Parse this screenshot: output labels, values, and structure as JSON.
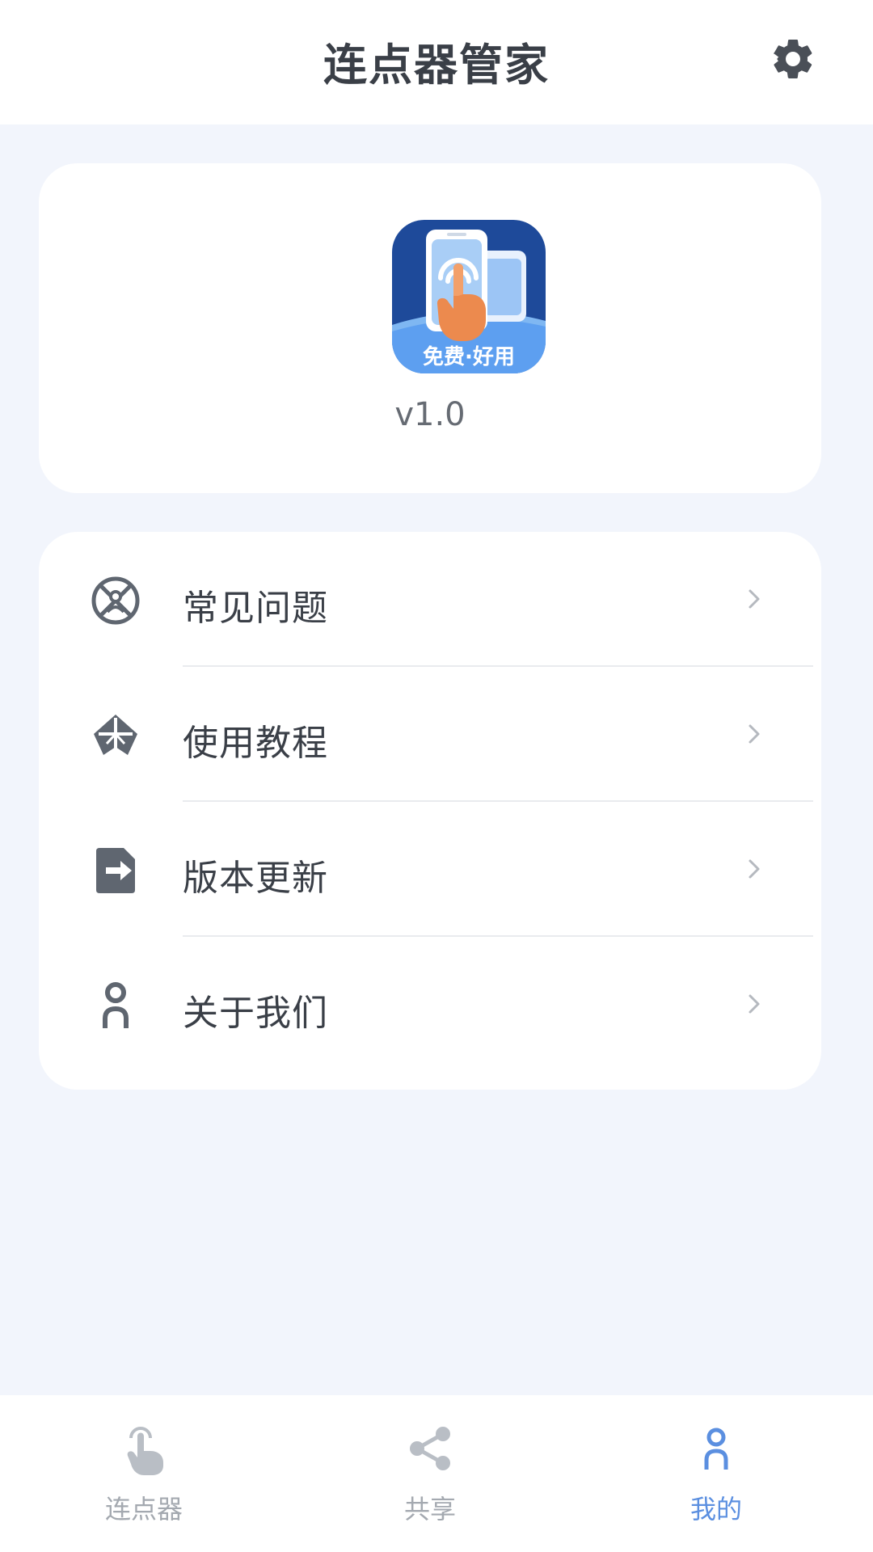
{
  "header": {
    "title": "连点器管家",
    "settings_icon": "gear-icon"
  },
  "version_card": {
    "logo_text": "免费·好用",
    "version": "v1.0"
  },
  "menu": {
    "items": [
      {
        "label": "常见问题",
        "icon": "faq-icon"
      },
      {
        "label": "使用教程",
        "icon": "tutorial-icon"
      },
      {
        "label": "版本更新",
        "icon": "update-icon"
      },
      {
        "label": "关于我们",
        "icon": "about-icon"
      }
    ]
  },
  "bottom_nav": {
    "items": [
      {
        "label": "连点器",
        "icon": "tap-hand-icon",
        "active": false
      },
      {
        "label": "共享",
        "icon": "share-icon",
        "active": false
      },
      {
        "label": "我的",
        "icon": "profile-icon",
        "active": true
      }
    ]
  },
  "colors": {
    "background": "#f2f5fc",
    "card": "#ffffff",
    "icon": "#5f6670",
    "active_tab": "#5b8fe0",
    "inactive_tab": "#a4a9b0",
    "logo_blue": "#1e4a9a",
    "logo_orange": "#ec8a4e"
  }
}
